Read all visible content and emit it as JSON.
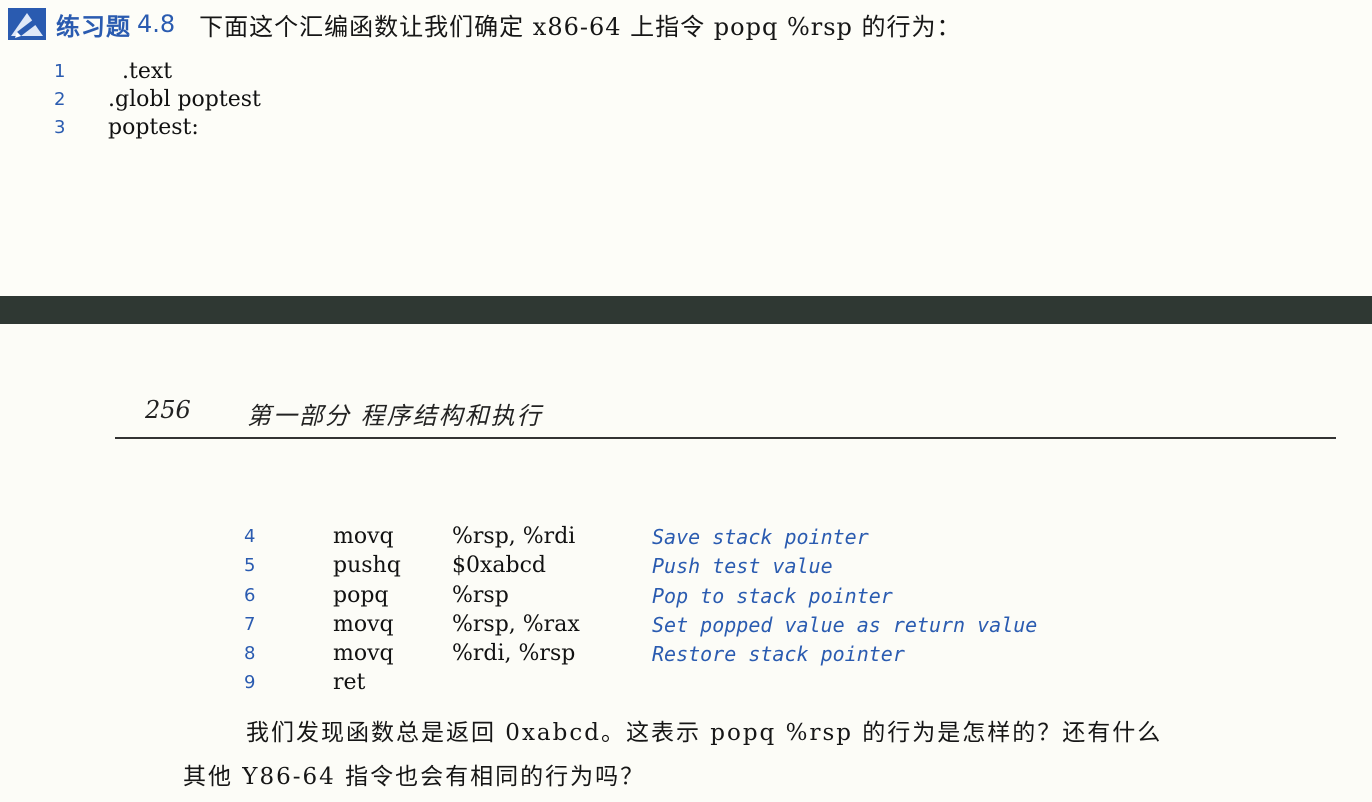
{
  "exercise": {
    "label": "练习题",
    "number": "4.8",
    "prompt": "下面这个汇编函数让我们确定 x86-64 上指令 popq %rsp 的行为："
  },
  "top_code": [
    {
      "num": "1",
      "code": "  .text"
    },
    {
      "num": "2",
      "code": ".globl poptest"
    },
    {
      "num": "3",
      "code": "poptest:"
    }
  ],
  "page_header": {
    "page_number": "256",
    "part_title": "第一部分   程序结构和执行"
  },
  "bottom_code": [
    {
      "num": "4",
      "op": "movq",
      "args": "%rsp, %rdi",
      "comment": "Save stack pointer"
    },
    {
      "num": "5",
      "op": "pushq",
      "args": "$0xabcd",
      "comment": "Push test value"
    },
    {
      "num": "6",
      "op": "popq",
      "args": "%rsp",
      "comment": "Pop to stack pointer"
    },
    {
      "num": "7",
      "op": "movq",
      "args": "%rsp, %rax",
      "comment": "Set popped value as return value"
    },
    {
      "num": "8",
      "op": "movq",
      "args": "%rdi, %rsp",
      "comment": "Restore stack pointer"
    },
    {
      "num": "9",
      "op": "ret",
      "args": "",
      "comment": ""
    }
  ],
  "paragraph": {
    "line1": "我们发现函数总是返回 0xabcd。这表示 popq %rsp 的行为是怎样的？还有什么",
    "line2": "其他 Y86-64 指令也会有相同的行为吗？"
  },
  "colors": {
    "accent_blue": "#2a5bb0",
    "divider": "#2f3833",
    "page_bg": "#fbfbf6"
  },
  "icons": {
    "exercise": "exercise-pencil-icon"
  }
}
